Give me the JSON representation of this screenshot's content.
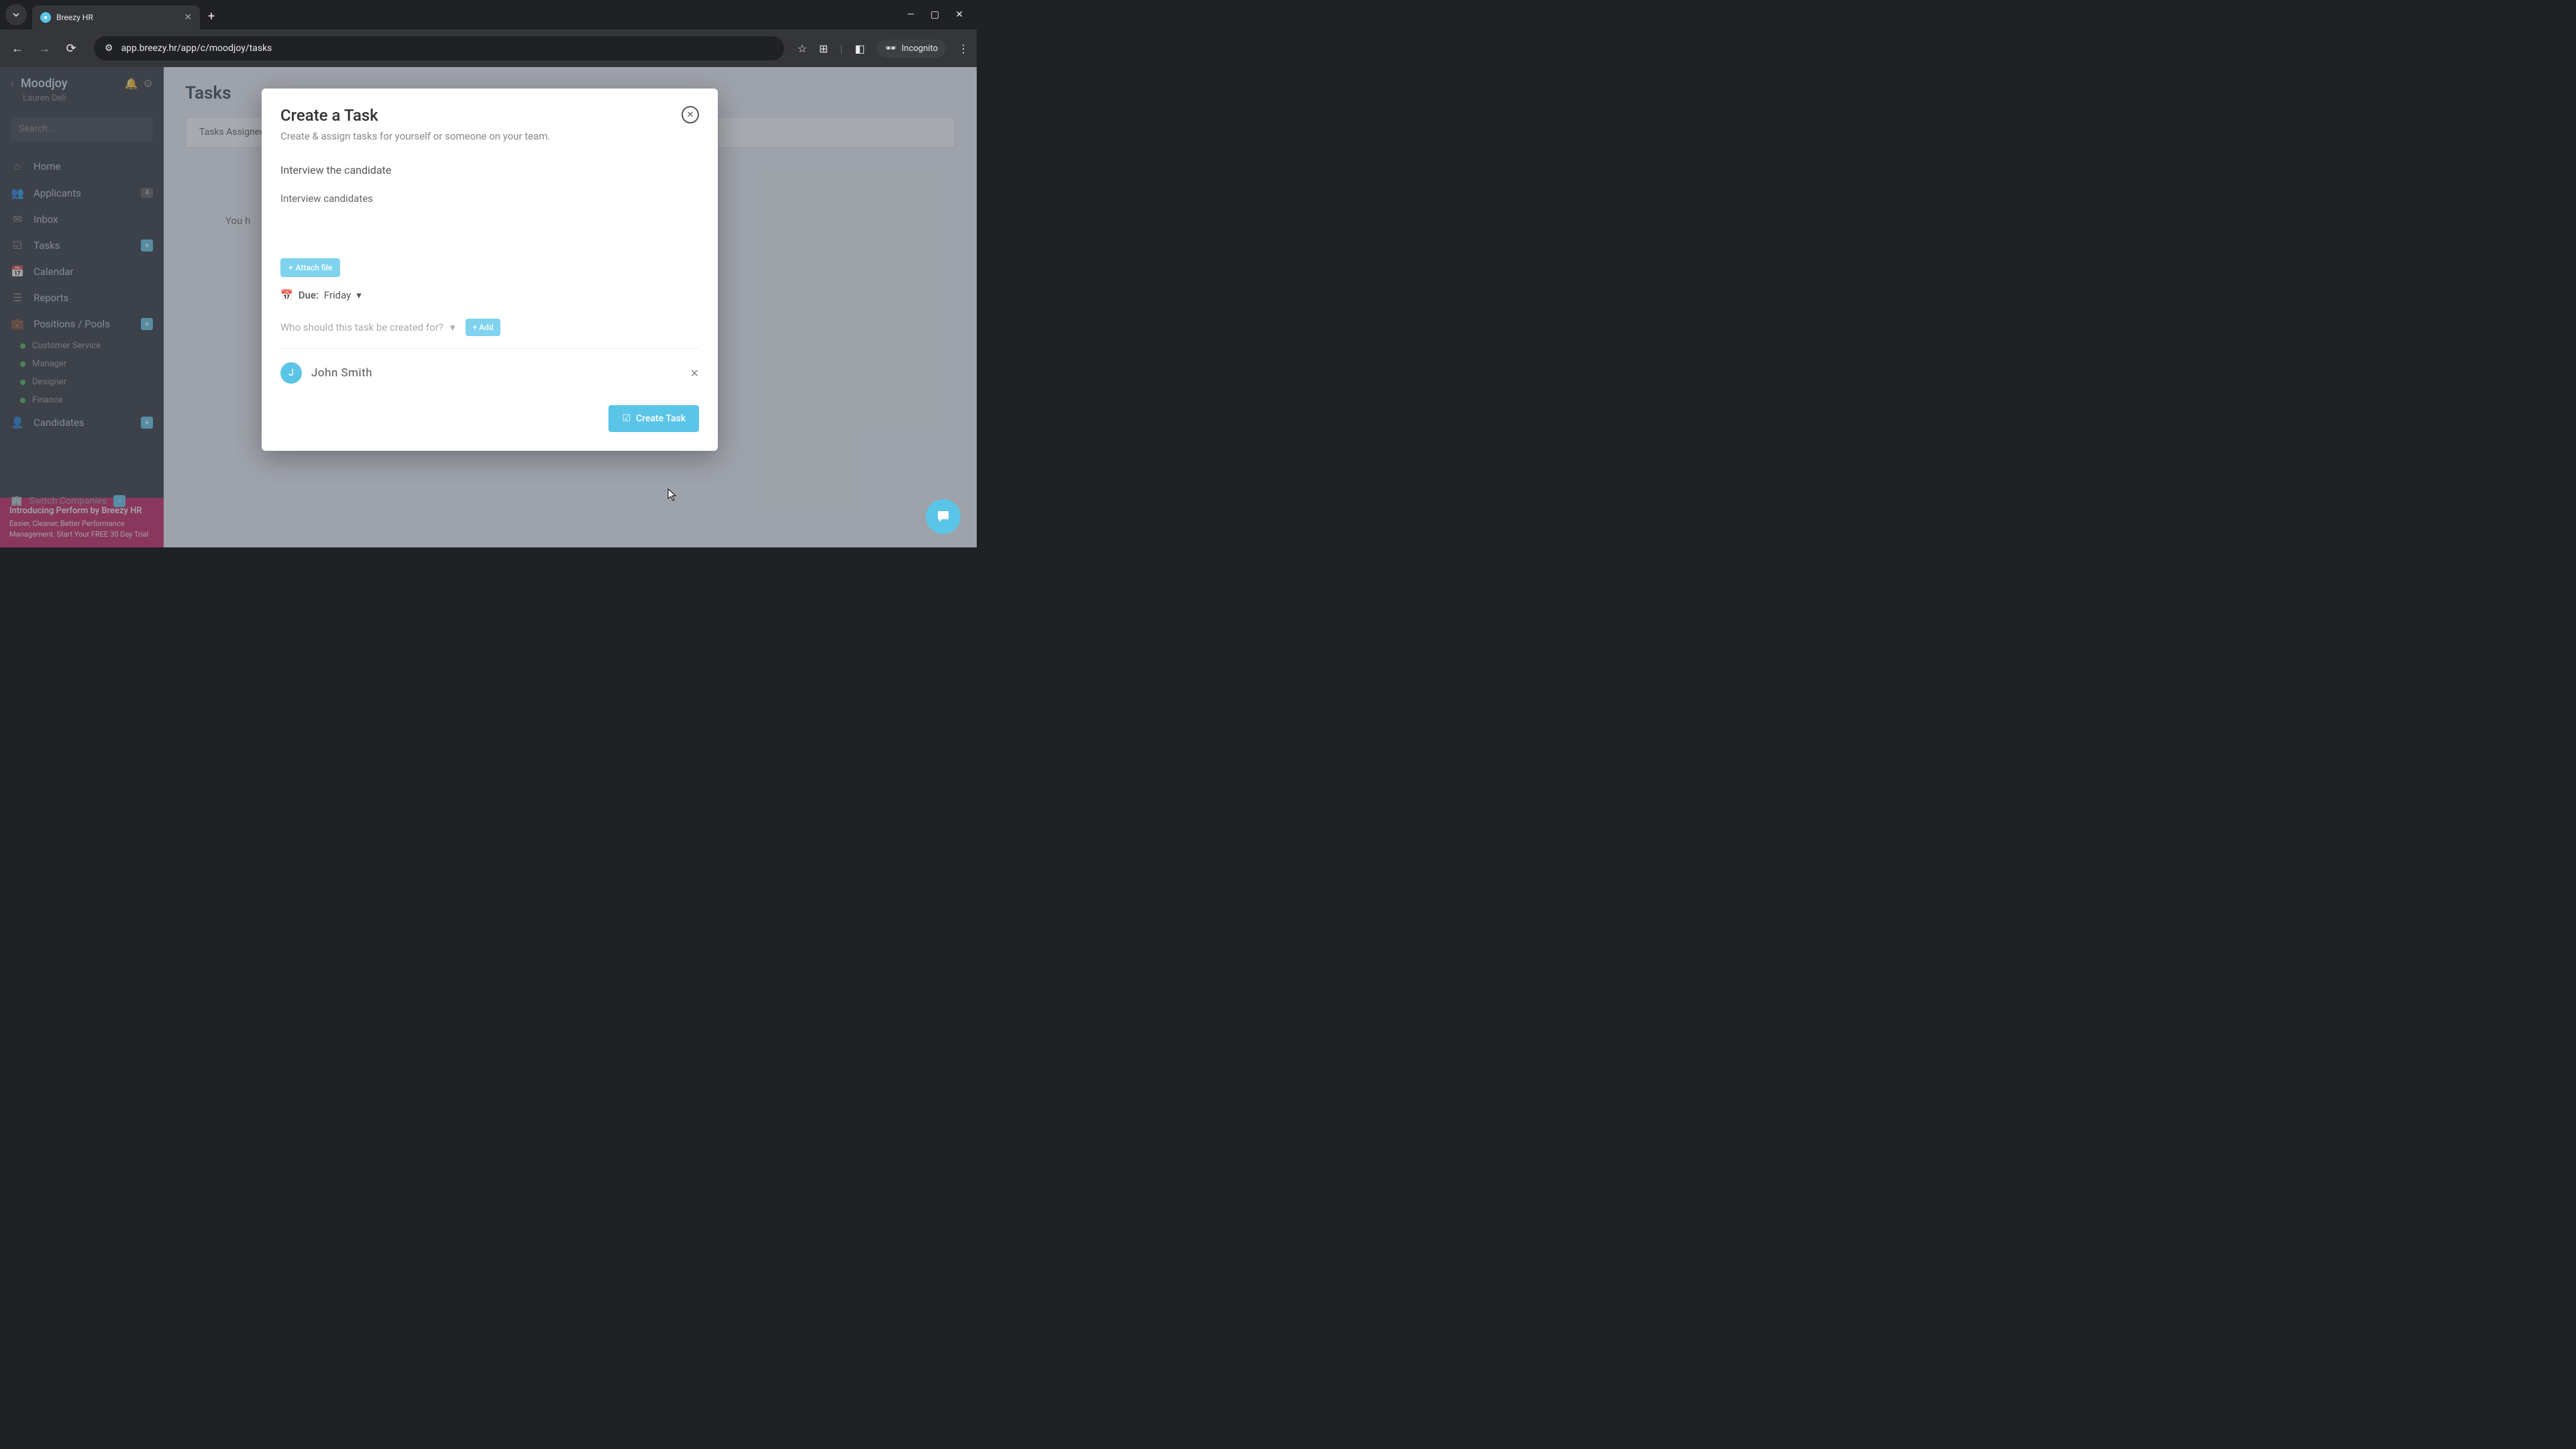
{
  "browser": {
    "tab_title": "Breezy HR",
    "url": "app.breezy.hr/app/c/moodjoy/tasks",
    "incognito_label": "Incognito"
  },
  "sidebar": {
    "workspace": "Moodjoy",
    "user": "Lauren Deli",
    "search_placeholder": "Search...",
    "items": [
      {
        "icon": "home",
        "label": "Home"
      },
      {
        "icon": "users",
        "label": "Applicants",
        "badge": "4"
      },
      {
        "icon": "envelope",
        "label": "Inbox"
      },
      {
        "icon": "check",
        "label": "Tasks",
        "plus": true
      },
      {
        "icon": "calendar",
        "label": "Calendar"
      },
      {
        "icon": "list",
        "label": "Reports"
      },
      {
        "icon": "briefcase",
        "label": "Positions / Pools",
        "plus": true
      }
    ],
    "sub_items": [
      {
        "label": "Customer Service"
      },
      {
        "label": "Manager"
      },
      {
        "label": "Designer"
      },
      {
        "label": "Finance"
      }
    ],
    "candidates_label": "Candidates",
    "promo_title": "Introducing Perform by Breezy HR",
    "promo_text": "Easier, Cleaner, Better Performance Management. Start Your FREE 30 Day Trial",
    "switch_label": "Switch Companies"
  },
  "page": {
    "title": "Tasks",
    "tab_assigned": "Tasks Assigned",
    "empty_partial": "You h"
  },
  "modal": {
    "title": "Create a Task",
    "subtitle": "Create & assign tasks for yourself or someone on your team.",
    "task_title_value": "Interview the candidate",
    "task_desc_value": "Interview candidates",
    "attach_label": "Attach file",
    "due_prefix": "Due:",
    "due_value": "Friday",
    "assign_placeholder": "Who should this task be created for?",
    "add_label": "Add",
    "assignee": {
      "initial": "J",
      "name": "John Smith"
    },
    "create_label": "Create Task"
  }
}
